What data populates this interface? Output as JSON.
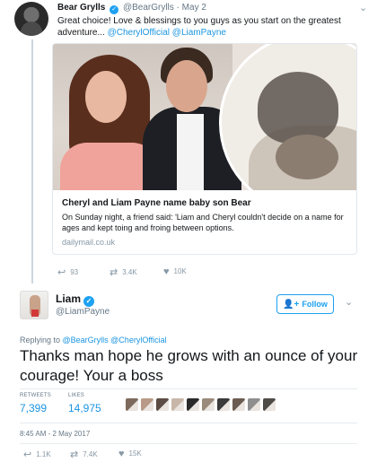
{
  "parent_tweet": {
    "name": "Bear Grylls",
    "handle": "@BearGrylls",
    "separator": "·",
    "date": "May 2",
    "text": "Great choice! Love & blessings to you guys as you start on the greatest adventure... ",
    "mentions": "@CherylOfficial @LiamPayne",
    "card": {
      "title": "Cheryl and Liam Payne name baby son Bear",
      "description": "On Sunday night, a friend said: 'Liam and Cheryl couldn't decide on a name for ages and kept toing and froing between options.",
      "domain": "dailymail.co.uk"
    },
    "actions": {
      "replies": "93",
      "retweets": "3.4K",
      "likes": "10K"
    }
  },
  "main_tweet": {
    "name": "Liam",
    "handle": "@LiamPayne",
    "follow_label": "Follow",
    "replying_prefix": "Replying to ",
    "replying_to": "@BearGrylls @CherylOfficial",
    "text": "Thanks man hope he grows with an ounce of your courage! Your a boss",
    "retweets_label": "RETWEETS",
    "retweets_count": "7,399",
    "likes_label": "LIKES",
    "likes_count": "14,975",
    "liker_avatars": [
      "#7d6a5c",
      "#b89a86",
      "#5c4c44",
      "#c8b6a8",
      "#2a2a2a",
      "#9a8a7c",
      "#3a3a3a",
      "#6b5c52",
      "#8e8e8e",
      "#4e4a46"
    ],
    "timestamp": "8:45 AM - 2 May 2017",
    "actions": {
      "replies": "1.1K",
      "retweets": "7.4K",
      "likes": "15K"
    }
  },
  "icons": {
    "verified": "✓",
    "chevron": "⌄",
    "reply": "↩",
    "retweet": "⇄",
    "like": "♥",
    "follow": "👤+"
  },
  "colors": {
    "accent": "#1da1f2",
    "link": "#1b95e0",
    "muted": "#657786"
  }
}
